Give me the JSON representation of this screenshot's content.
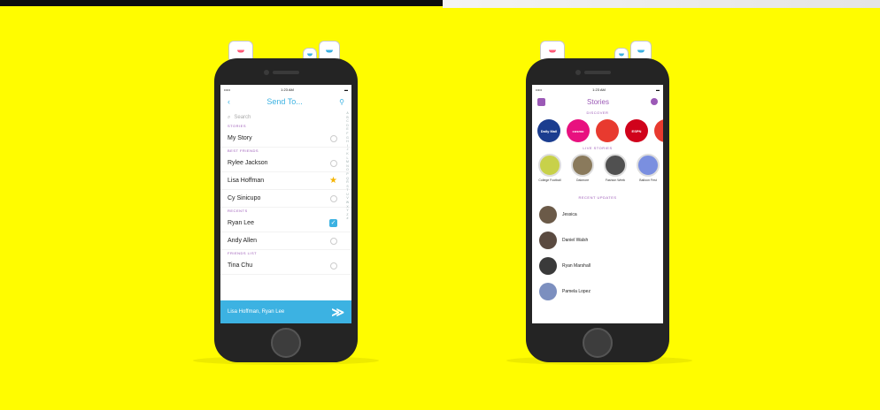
{
  "colors": {
    "background": "#FFFC00",
    "accent_blue": "#3CB2E2",
    "accent_purple": "#9B59B6",
    "phone_body": "#242424"
  },
  "send_to_screen": {
    "status": {
      "left": "•••••",
      "time": "1:23 AM",
      "right": "▬"
    },
    "back_icon": "back-chevron-icon",
    "title": "Send To...",
    "corner_icon": "add-friend-icon",
    "search_placeholder": "Search",
    "sections": [
      {
        "label": "STORIES",
        "rows": [
          {
            "name": "My Story",
            "state": "circle"
          }
        ]
      },
      {
        "label": "BEST FRIENDS",
        "rows": [
          {
            "name": "Rylee Jackson",
            "state": "circle"
          },
          {
            "name": "Lisa Hoffman",
            "state": "star"
          },
          {
            "name": "Cy Sinicupo",
            "state": "circle"
          }
        ]
      },
      {
        "label": "RECENTS",
        "rows": [
          {
            "name": "Ryan Lee",
            "state": "check"
          },
          {
            "name": "Andy Allen",
            "state": "circle"
          }
        ]
      },
      {
        "label": "FRIENDS LIST",
        "rows": [
          {
            "name": "Tina Chu",
            "state": "circle"
          }
        ]
      }
    ],
    "alphabet": [
      "A",
      "B",
      "C",
      "D",
      "E",
      "F",
      "G",
      "H",
      "I",
      "J",
      "K",
      "L",
      "M",
      "N",
      "O",
      "P",
      "Q",
      "R",
      "S",
      "T",
      "U",
      "V",
      "W",
      "X",
      "Y",
      "Z",
      "#"
    ],
    "send_bar_text": "Lisa Hoffman, Ryan Lee",
    "send_icon": "send-arrow-icon"
  },
  "stories_screen": {
    "status": {
      "left": "•••••",
      "time": "1:23 AM",
      "right": "▬"
    },
    "title": "Stories",
    "discover_label": "DISCOVER",
    "discover": [
      {
        "text": "Daily Mail",
        "color": "#1B3D8F"
      },
      {
        "text": "cosmo",
        "color": "#E8117F"
      },
      {
        "text": "",
        "color": "#E83A2F"
      },
      {
        "text": "ESPN",
        "color": "#D0021B"
      },
      {
        "text": "",
        "color": "#E83A2F"
      }
    ],
    "live_label": "LIVE STORIES",
    "live": [
      {
        "label": "College Football",
        "color": "#C8D14A"
      },
      {
        "label": "Oakmore",
        "color": "#8A7A5C"
      },
      {
        "label": "Fashion Week",
        "color": "#505050"
      },
      {
        "label": "Balloon Fest",
        "color": "#7A8FE0"
      }
    ],
    "recent_label": "RECENT UPDATES",
    "recent": [
      {
        "name": "Jessica",
        "color": "#6B5A48"
      },
      {
        "name": "Daniel Walsh",
        "color": "#5A4A40"
      },
      {
        "name": "Ryan Marshall",
        "color": "#3A3A3A"
      },
      {
        "name": "Pamela Lopez",
        "color": "#7C8FBF"
      }
    ]
  }
}
